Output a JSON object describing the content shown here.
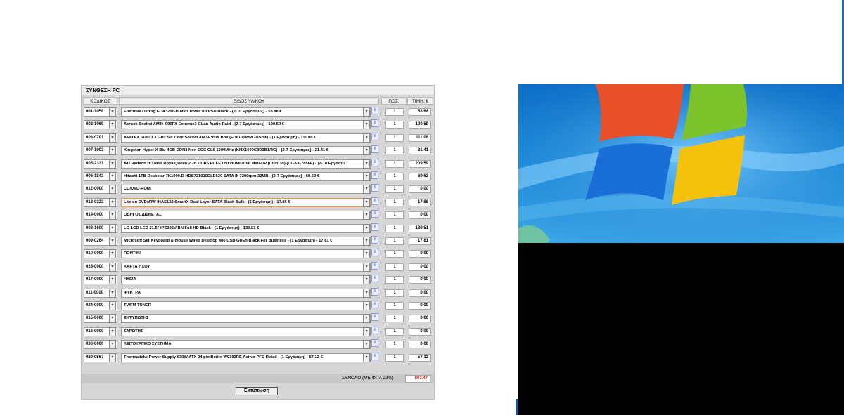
{
  "panel": {
    "title": "ΣΥΝΘΕΣΗ PC",
    "columns": {
      "code": "ΚΩΔΙΚΟΣ",
      "item": "ΕΙΔΟΣ ΥΛΙΚΟΥ",
      "qty": "ΠΟΣ.",
      "price": "ΤΙΜΗ, €"
    },
    "info_label": "i",
    "rows": [
      {
        "code": "001-1058",
        "item": "Enermax Ostrog ECA3250-B Midi Tower no PSU Black - (2-10 Εργάσιμες) - 58.88 €",
        "qty": "1",
        "price": "58.88"
      },
      {
        "code": "002-1069",
        "item": "Asrock Socket AM3+ 990FX Extreme3 GLan Audio Raid - (2-7 Εργάσιμες) - 100.59 €",
        "qty": "1",
        "price": "100.59"
      },
      {
        "code": "003-0701",
        "item": "AMD FX 6100 3.3 GHz Six Core Socket AM3+ 95W Box (FD6100WMGUSBX) - (1 Εργάσιμη) - 111.08 €",
        "qty": "1",
        "price": "111.08"
      },
      {
        "code": "007-1003",
        "item": "Kingston Hyper X Blu 4GB DDR3 Non ECC CL9 1600MHz (KHX1600C9D3B1/4G) - (2-7 Εργάσιμες) - 21.41 €",
        "qty": "1",
        "price": "21.41"
      },
      {
        "code": "005-2331",
        "item": "ATI Radeon HD7850 RoyalQueen 2GB DDR5 PCI-E DVI HDMI Dual Mini-DP (Club 3d) (CGAX-7856F) - (2-10 Εργάσιμ",
        "qty": "1",
        "price": "209.59"
      },
      {
        "code": "006-1843",
        "item": "Hitachi 1TB Deskstar 7K1000.D HDS721010DLE630 SATA III 7200rpm 32MB - (2-7 Εργάσιμες) - 69.62 €",
        "qty": "1",
        "price": "69.62"
      },
      {
        "code": "012-0000",
        "item": "CD/DVD-ROM",
        "qty": "1",
        "price": "0.00"
      },
      {
        "code": "013-0323",
        "item": "Lite on DVD±RW iHAS122 SmartX Dual Layer SATA Black Bulk - (1 Εργάσιμη) - 17.86 €",
        "qty": "1",
        "price": "17.86"
      },
      {
        "code": "014-0000",
        "item": "ΟΔΗΓΟΣ ΔΙΣΚΕΤΑΣ",
        "qty": "1",
        "price": "0.00"
      },
      {
        "code": "008-1600",
        "item": "LG LCD LED 21.5\" IPS225V-BN Full HD Black - (1 Εργάσιμη) - 139.51 €",
        "qty": "1",
        "price": "139.51"
      },
      {
        "code": "009-0264",
        "item": "Microsoft Set Keyboard & mouse Wired Desktop 400 USB Gr/En Black For Business - (1 Εργάσιμη) - 17.81 €",
        "qty": "1",
        "price": "17.81"
      },
      {
        "code": "010-0000",
        "item": "ΠΟΝΤΙΚΙ",
        "qty": "1",
        "price": "0.00"
      },
      {
        "code": "028-0000",
        "item": "ΚΑΡΤΑ ΗΧΟΥ",
        "qty": "1",
        "price": "0.00"
      },
      {
        "code": "017-0000",
        "item": "ΗΧΕΙΑ",
        "qty": "1",
        "price": "0.00"
      },
      {
        "code": "011-0000",
        "item": "ΨΥΚΤΡΑ",
        "qty": "1",
        "price": "0.00"
      },
      {
        "code": "024-0000",
        "item": "TV/FM TUNER",
        "qty": "1",
        "price": "0.00"
      },
      {
        "code": "015-0000",
        "item": "ΕΚΤΥΠΩΤΗΣ",
        "qty": "1",
        "price": "0.00"
      },
      {
        "code": "016-0000",
        "item": "ΣΑΡΩΤΗΣ",
        "qty": "1",
        "price": "0.00"
      },
      {
        "code": "030-0000",
        "item": "ΛΕΙΤΟΥΡΓΙΚΟ ΣΥΣΤΗΜΑ",
        "qty": "1",
        "price": "0.00"
      },
      {
        "code": "029-0567",
        "item": "Thermaltake Power Supply 630W ATX 24 pin Berlin W0393RE Active-PFC Retail - (1 Εργάσιμη) - 57.12 €",
        "qty": "1",
        "price": "57.12"
      }
    ],
    "total_label": "ΣΥΝΟΛΟ (ΜΕ ΦΠΑ 23%)",
    "total_value": "803.47",
    "print_label": "Εκτύπωση"
  },
  "desktop": {
    "wallpaper": "windows-7-logo",
    "colors": {
      "sky": "#1c8ad9",
      "flag_red": "#e8502a",
      "flag_green": "#7cc22c",
      "flag_blue": "#1a6ed8",
      "flag_yellow": "#f4c20d"
    }
  }
}
